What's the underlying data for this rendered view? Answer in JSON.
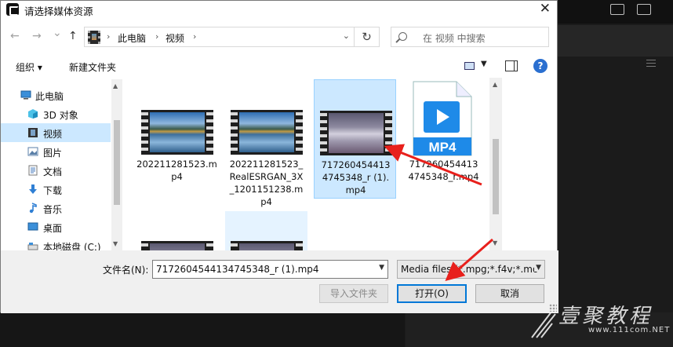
{
  "dialog": {
    "title": "请选择媒体资源",
    "close_glyph": "✕"
  },
  "nav": {
    "back_glyph": "←",
    "forward_glyph": "→",
    "recent_glyph": "⌄",
    "up_glyph": "↑",
    "breadcrumb": [
      "此电脑",
      "视频"
    ],
    "refresh_glyph": "↻",
    "search_placeholder": "在 视频 中搜索"
  },
  "toolbar": {
    "organize_label": "组织 ▾",
    "new_folder_label": "新建文件夹",
    "help_glyph": "?"
  },
  "tree": {
    "items": [
      {
        "label": "此电脑",
        "icon": "pc-icon"
      },
      {
        "label": "3D 对象",
        "icon": "3d-objects-icon"
      },
      {
        "label": "视频",
        "icon": "video-folder-icon"
      },
      {
        "label": "图片",
        "icon": "pictures-icon"
      },
      {
        "label": "文档",
        "icon": "documents-icon"
      },
      {
        "label": "下载",
        "icon": "downloads-icon"
      },
      {
        "label": "音乐",
        "icon": "music-icon"
      },
      {
        "label": "桌面",
        "icon": "desktop-icon"
      },
      {
        "label": "本地磁盘 (C:)",
        "icon": "drive-icon"
      }
    ],
    "selected_index": 2
  },
  "files": [
    {
      "name": "202211281523.mp4",
      "thumb": "lake"
    },
    {
      "name": "202211281523_RealESRGAN_3X_1201151238.mp4",
      "thumb": "lake"
    },
    {
      "name": "7172604544134745348_r (1).mp4",
      "thumb": "night",
      "selected": true
    },
    {
      "name": "7172604544134745348_r.mp4",
      "thumb": "mp4-doc",
      "badge": "MP4"
    }
  ],
  "bottom": {
    "filename_label": "文件名(N):",
    "filename_value": "7172604544134745348_r (1).mp4",
    "filetype_value": "Media files (*.mpg;*.f4v;*.mo",
    "import_folder_label": "导入文件夹",
    "open_label": "打开(O)",
    "cancel_label": "取消"
  },
  "watermark": {
    "text": "壹聚教程",
    "url": "www.111com.NET"
  },
  "colors": {
    "selection": "#cce8ff",
    "accent": "#0078d7",
    "arrow": "#e8201c",
    "mp4_blue": "#1e8ae8"
  }
}
